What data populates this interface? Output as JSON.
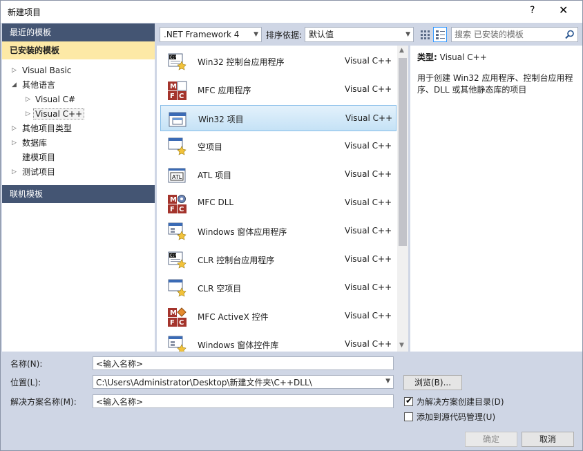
{
  "window": {
    "title": "新建项目",
    "help": "?",
    "close": "✕"
  },
  "sidebar": {
    "recent": "最近的模板",
    "installed": "已安装的模板",
    "online": "联机模板",
    "tree": [
      {
        "label": "Visual Basic",
        "level": 0,
        "arrow": "▷"
      },
      {
        "label": "其他语言",
        "level": 0,
        "arrow": "◢"
      },
      {
        "label": "Visual C#",
        "level": 1,
        "arrow": "▷"
      },
      {
        "label": "Visual C++",
        "level": 1,
        "arrow": "▷",
        "selected": true
      },
      {
        "label": "其他项目类型",
        "level": 0,
        "arrow": "▷"
      },
      {
        "label": "数据库",
        "level": 0,
        "arrow": "▷"
      },
      {
        "label": "建模项目",
        "level": 0,
        "arrow": ""
      },
      {
        "label": "测试项目",
        "level": 0,
        "arrow": "▷"
      }
    ]
  },
  "toolbar": {
    "framework": ".NET Framework 4",
    "sort_label": "排序依据:",
    "sort_value": "默认值",
    "search_placeholder": "搜索 已安装的模板"
  },
  "templates": [
    {
      "name": "Win32 控制台应用程序",
      "lang": "Visual C++",
      "icon": "console-icon"
    },
    {
      "name": "MFC 应用程序",
      "lang": "Visual C++",
      "icon": "mfc-icon"
    },
    {
      "name": "Win32 项目",
      "lang": "Visual C++",
      "icon": "window-icon",
      "selected": true
    },
    {
      "name": "空项目",
      "lang": "Visual C++",
      "icon": "empty-project-icon"
    },
    {
      "name": "ATL 项目",
      "lang": "Visual C++",
      "icon": "atl-icon"
    },
    {
      "name": "MFC DLL",
      "lang": "Visual C++",
      "icon": "mfc-dll-icon"
    },
    {
      "name": "Windows 窗体应用程序",
      "lang": "Visual C++",
      "icon": "winforms-icon"
    },
    {
      "name": "CLR 控制台应用程序",
      "lang": "Visual C++",
      "icon": "console-icon"
    },
    {
      "name": "CLR 空项目",
      "lang": "Visual C++",
      "icon": "empty-project-icon"
    },
    {
      "name": "MFC ActiveX 控件",
      "lang": "Visual C++",
      "icon": "mfc-activex-icon"
    },
    {
      "name": "Windows 窗体控件库",
      "lang": "Visual C++",
      "icon": "winforms-icon"
    }
  ],
  "description": {
    "type_label": "类型:",
    "type_value": "Visual C++",
    "text": "用于创建 Win32 应用程序、控制台应用程序、DLL 或其他静态库的项目"
  },
  "form": {
    "name_label": "名称(N):",
    "name_value": "<输入名称>",
    "location_label": "位置(L):",
    "location_value": "C:\\Users\\Administrator\\Desktop\\新建文件夹\\C++DLL\\",
    "browse_label": "浏览(B)...",
    "solution_label": "解决方案名称(M):",
    "solution_value": "<输入名称>",
    "create_dir_label": "为解决方案创建目录(D)",
    "create_dir_checked": true,
    "source_control_label": "添加到源代码管理(U)",
    "source_control_checked": false
  },
  "buttons": {
    "ok": "确定",
    "cancel": "取消"
  }
}
